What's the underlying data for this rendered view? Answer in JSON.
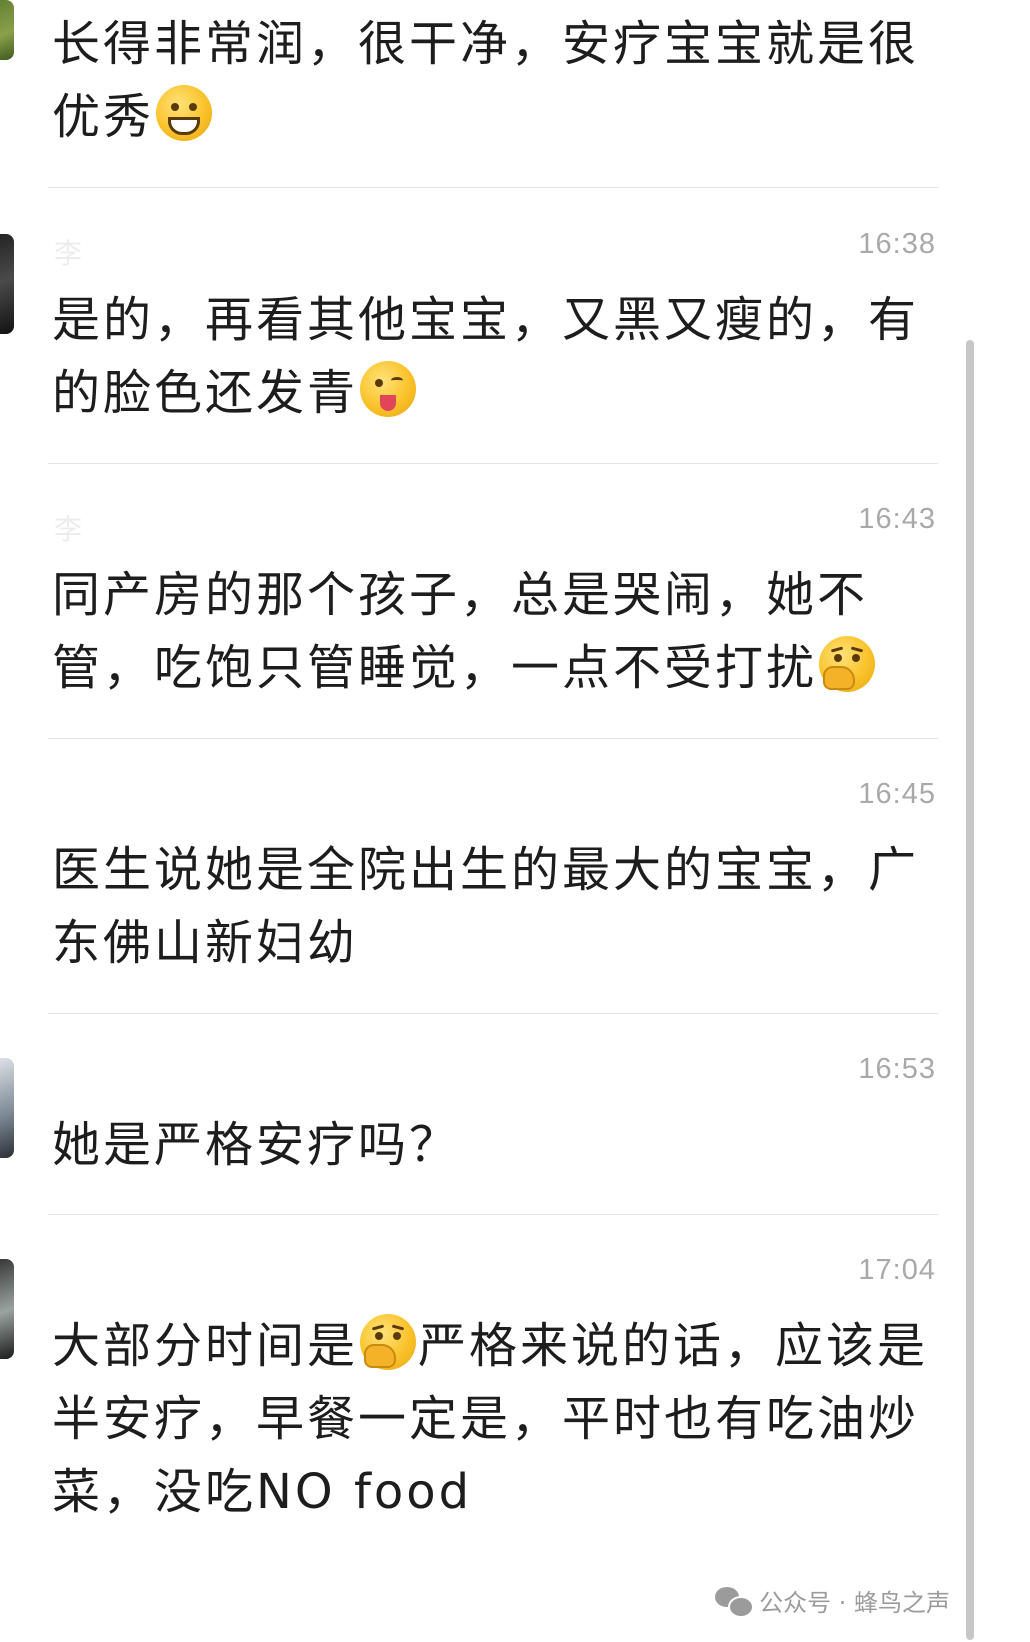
{
  "messages": [
    {
      "sender": "",
      "time": "",
      "text_parts": [
        "长得非常润，很干净，安疗宝宝就是很优秀"
      ],
      "emoji": "grinning-face"
    },
    {
      "sender": "李",
      "time": "16:38",
      "text_parts": [
        "是的，再看其他宝宝，又黑又瘦的，有的脸色还发青"
      ],
      "emoji": "winking-face-with-tongue"
    },
    {
      "sender": "李",
      "time": "16:43",
      "text_parts": [
        "同产房的那个孩子，总是哭闹，她不管，吃饱只管睡觉，一点不受打扰"
      ],
      "emoji": "face-with-hand-over-mouth"
    },
    {
      "sender": "",
      "time": "16:45",
      "text_parts": [
        "医生说她是全院出生的最大的宝宝，广东佛山新妇幼"
      ],
      "emoji": ""
    },
    {
      "sender": "",
      "time": "16:53",
      "text_parts": [
        "她是严格安疗吗？"
      ],
      "emoji": ""
    },
    {
      "sender": "",
      "time": "17:04",
      "text_before": "大部分时间是",
      "text_after": "严格来说的话，应该是半安疗，早餐一定是，平时也有吃油炒菜，没吃NO food",
      "emoji": "face-with-hand-over-mouth"
    }
  ],
  "watermark": {
    "label": "公众号 · 蜂鸟之声",
    "icon": "wechat-icon"
  }
}
